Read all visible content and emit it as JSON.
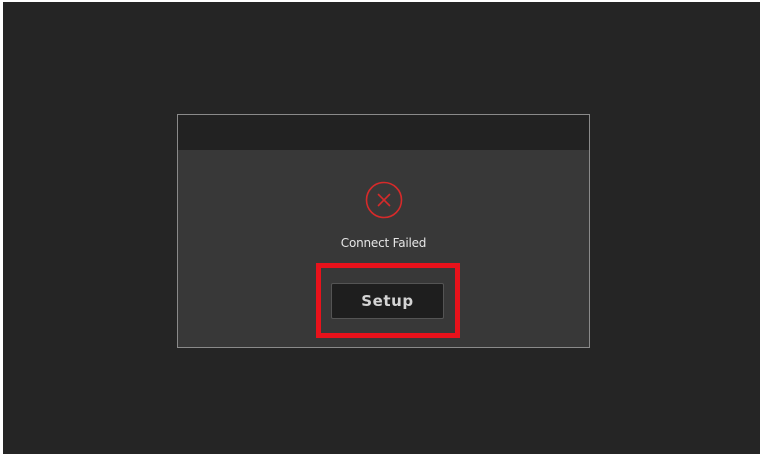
{
  "dialog": {
    "title": "",
    "message": "Connect Failed",
    "icon": "error-circle-x-icon",
    "icon_color": "#d62a2a",
    "setup_label": "Setup",
    "highlight_color": "#e8121b"
  }
}
